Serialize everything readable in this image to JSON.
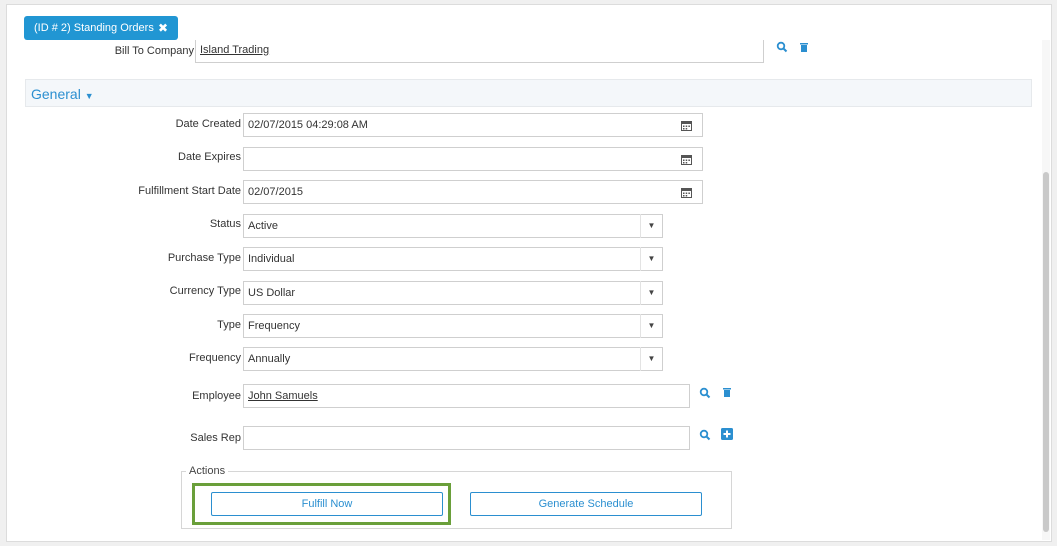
{
  "tab": {
    "label": "(ID # 2) Standing Orders"
  },
  "bill_to": {
    "label": "Bill To Company",
    "value": "Island Trading"
  },
  "section": {
    "title": "General"
  },
  "fields": {
    "date_created": {
      "label": "Date Created",
      "value": "02/07/2015 04:29:08 AM"
    },
    "date_expires": {
      "label": "Date Expires",
      "value": ""
    },
    "fulfillment_start": {
      "label": "Fulfillment Start Date",
      "value": "02/07/2015"
    },
    "status": {
      "label": "Status",
      "value": "Active"
    },
    "purchase_type": {
      "label": "Purchase Type",
      "value": "Individual"
    },
    "currency_type": {
      "label": "Currency Type",
      "value": "US Dollar"
    },
    "type": {
      "label": "Type",
      "value": "Frequency"
    },
    "frequency": {
      "label": "Frequency",
      "value": "Annually"
    },
    "employee": {
      "label": "Employee",
      "value": "John Samuels"
    },
    "sales_rep": {
      "label": "Sales Rep",
      "value": ""
    }
  },
  "actions": {
    "legend": "Actions",
    "fulfill_now": "Fulfill Now",
    "generate_schedule": "Generate Schedule"
  },
  "icons": {
    "close": "close-icon",
    "search": "search-icon",
    "delete": "trash-icon",
    "add": "plus-icon",
    "calendar": "calendar-icon",
    "dropdown": "chevron-down-icon"
  },
  "colors": {
    "accent": "#2196d3",
    "highlight": "#6a9f3a"
  }
}
